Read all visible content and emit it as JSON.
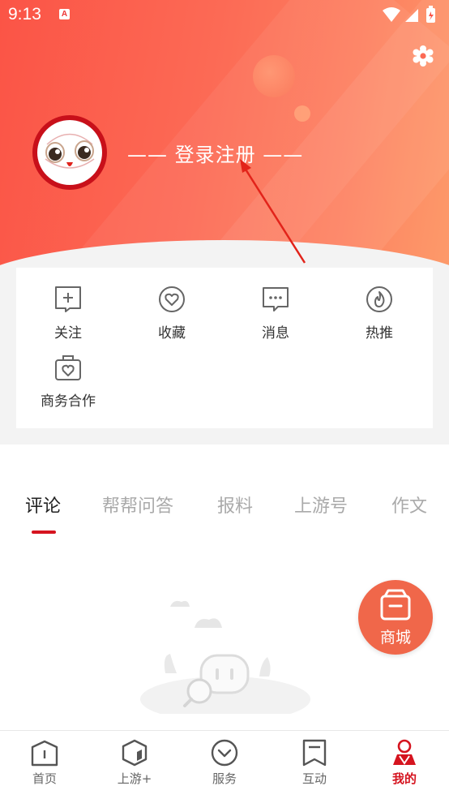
{
  "status_bar": {
    "time": "9:13",
    "badge": "A"
  },
  "profile": {
    "login_text": "—— 登录注册 ——"
  },
  "quick_actions": [
    {
      "label": "关注",
      "icon": "follow-icon"
    },
    {
      "label": "收藏",
      "icon": "favorite-icon"
    },
    {
      "label": "消息",
      "icon": "message-icon"
    },
    {
      "label": "热推",
      "icon": "hot-icon"
    },
    {
      "label": "商务合作",
      "icon": "business-icon"
    }
  ],
  "tabs": [
    {
      "label": "评论",
      "active": true
    },
    {
      "label": "帮帮问答",
      "active": false
    },
    {
      "label": "报料",
      "active": false
    },
    {
      "label": "上游号",
      "active": false
    },
    {
      "label": "作文",
      "active": false
    }
  ],
  "floating": {
    "shop_label": "商城"
  },
  "bottom_nav": [
    {
      "label": "首页",
      "icon": "home-icon",
      "active": false
    },
    {
      "label": "上游+",
      "icon": "shangyou-icon",
      "active": false
    },
    {
      "label": "服务",
      "icon": "service-icon",
      "active": false
    },
    {
      "label": "互动",
      "icon": "interact-icon",
      "active": false
    },
    {
      "label": "我的",
      "icon": "profile-icon",
      "active": true
    }
  ],
  "colors": {
    "accent": "#d5141f",
    "header_start": "#fb5446",
    "header_end": "#fd9a6a",
    "shop_button": "#f0674a"
  }
}
